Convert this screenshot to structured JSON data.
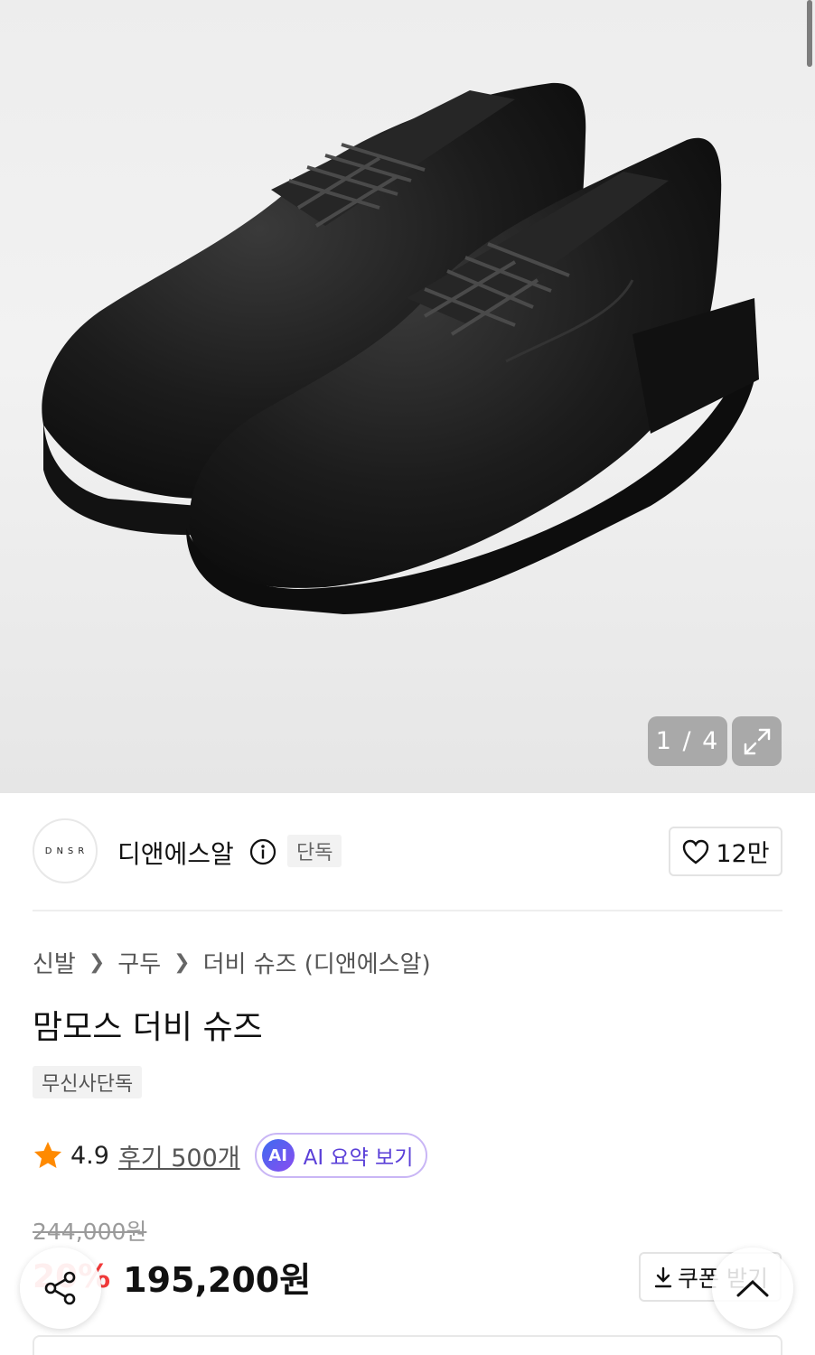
{
  "gallery": {
    "image_alt": "검정 더비 슈즈 한 켤레",
    "counter": "1 / 4"
  },
  "brand": {
    "logo_text": "DNSR",
    "name": "디앤에스알",
    "badge": "단독",
    "like_count": "12만"
  },
  "breadcrumb": [
    "신발",
    "구두",
    "더비 슈즈 (디앤에스알)"
  ],
  "product": {
    "title": "맘모스 더비 슈즈",
    "tag": "무신사단독"
  },
  "rating": {
    "score": "4.9",
    "reviews": "후기 500개",
    "ai_badge": "AI",
    "ai_label": "AI 요약 보기"
  },
  "price": {
    "original": "244,000원",
    "discount": "20%",
    "final": "195,200원"
  },
  "coupon": {
    "label": "쿠폰 받기"
  },
  "colors": {
    "discount_red": "#f23a3a",
    "star_orange": "#ff8a00",
    "ai_purple": "#5a3fd8"
  },
  "icons": [
    "info-icon",
    "heart-icon",
    "expand-icon",
    "star-icon",
    "download-icon",
    "share-icon",
    "chevron-up-icon"
  ]
}
